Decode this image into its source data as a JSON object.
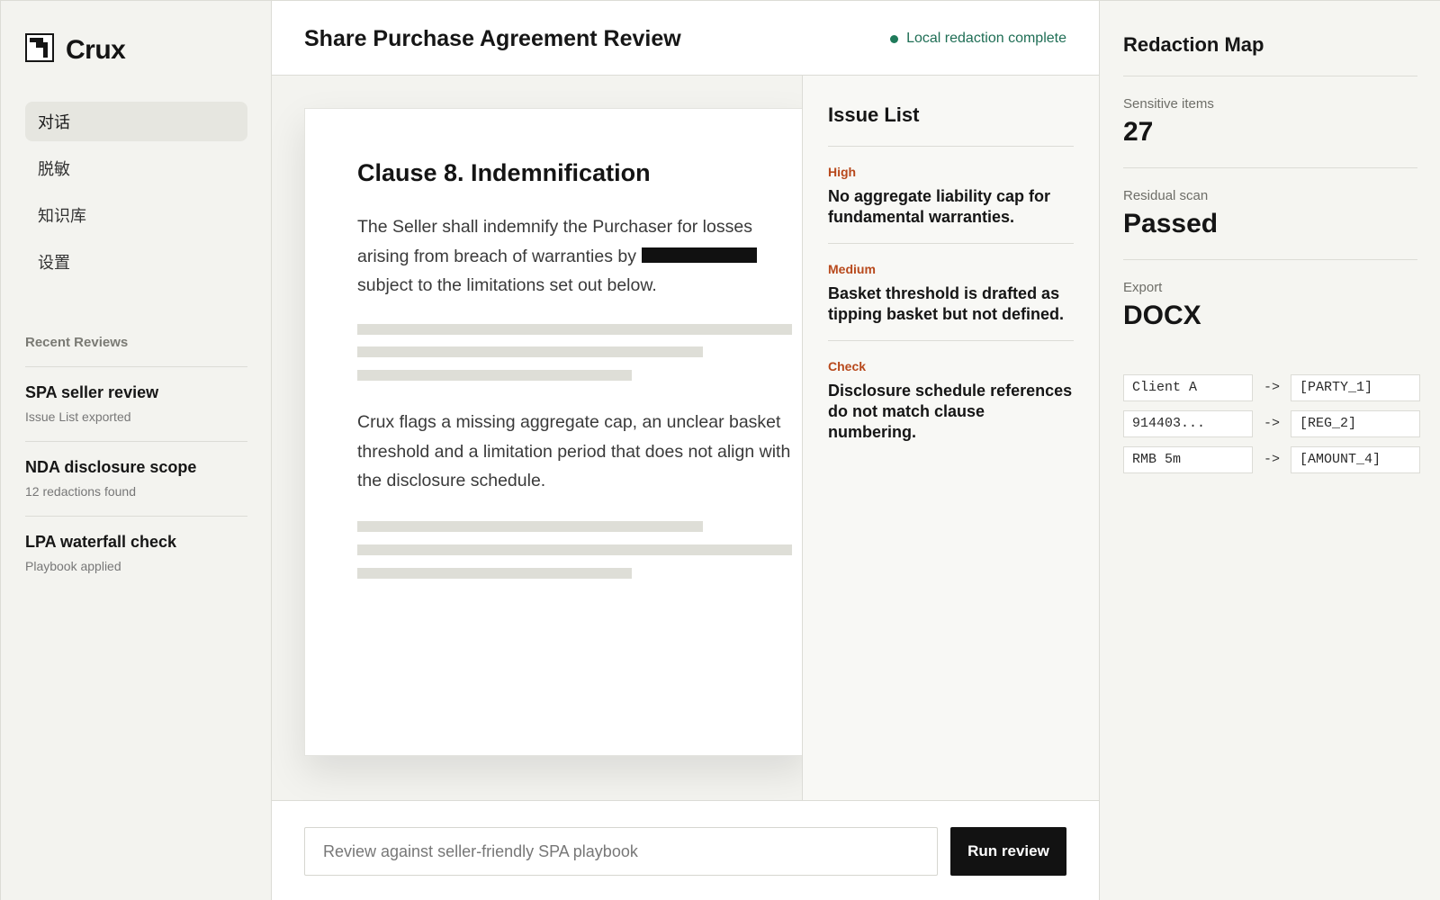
{
  "app": {
    "name": "Crux"
  },
  "sidebar": {
    "nav": [
      {
        "label": "对话",
        "active": true
      },
      {
        "label": "脱敏",
        "active": false
      },
      {
        "label": "知识库",
        "active": false
      },
      {
        "label": "设置",
        "active": false
      }
    ],
    "recent_heading": "Recent Reviews",
    "recent": [
      {
        "title": "SPA seller review",
        "subtitle": "Issue List exported"
      },
      {
        "title": "NDA disclosure scope",
        "subtitle": "12 redactions found"
      },
      {
        "title": "LPA waterfall check",
        "subtitle": "Playbook applied"
      }
    ]
  },
  "header": {
    "title": "Share Purchase Agreement Review",
    "status": "Local redaction complete",
    "status_color": "#1f7a5a"
  },
  "document": {
    "clause_title": "Clause 8. Indemnification",
    "paragraph1_before": "The Seller shall indemnify the Purchaser for losses arising from breach of warranties by",
    "paragraph1_after": "subject to the limitations set out below.",
    "paragraph2": "Crux flags a missing aggregate cap, an unclear basket threshold and a limitation period that does not align with the disclosure schedule."
  },
  "issues": {
    "title": "Issue List",
    "items": [
      {
        "level": "High",
        "text": "No aggregate liability cap for fundamental warranties."
      },
      {
        "level": "Medium",
        "text": "Basket threshold is drafted as tipping basket but not defined."
      },
      {
        "level": "Check",
        "text": "Disclosure schedule references do not match clause numbering."
      }
    ],
    "level_color": "#b8491c"
  },
  "composer": {
    "placeholder": "Review against seller-friendly SPA playbook",
    "run_label": "Run review"
  },
  "redaction_map": {
    "title": "Redaction Map",
    "stats": [
      {
        "label": "Sensitive items",
        "value": "27"
      },
      {
        "label": "Residual scan",
        "value": "Passed"
      },
      {
        "label": "Export",
        "value": "DOCX"
      }
    ],
    "arrow": "->",
    "mappings": [
      {
        "original": "Client A",
        "token": "[PARTY_1]"
      },
      {
        "original": "914403...",
        "token": "[REG_2]"
      },
      {
        "original": "RMB 5m",
        "token": "[AMOUNT_4]"
      }
    ]
  }
}
